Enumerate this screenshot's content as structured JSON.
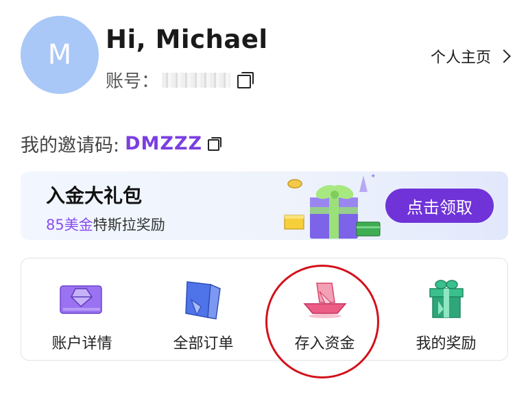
{
  "profile": {
    "avatar_initial": "M",
    "greeting": "Hi, Michael",
    "account_label": "账号：",
    "profile_link": "个人主页"
  },
  "invite": {
    "label": "我的邀请码:",
    "code": "DMZZZ"
  },
  "banner": {
    "title": "入金大礼包",
    "subtitle_highlight": "85美金",
    "subtitle_rest": "特斯拉奖励",
    "button": "点击领取"
  },
  "actions": [
    {
      "label": "账户详情",
      "icon": "card-icon"
    },
    {
      "label": "全部订单",
      "icon": "orders-icon"
    },
    {
      "label": "存入资金",
      "icon": "deposit-icon"
    },
    {
      "label": "我的奖励",
      "icon": "gift-icon"
    }
  ],
  "colors": {
    "accent": "#7b3fe0",
    "button": "#6f33d8",
    "avatar": "#a9c8f7",
    "highlight_circle": "#d3101a"
  }
}
